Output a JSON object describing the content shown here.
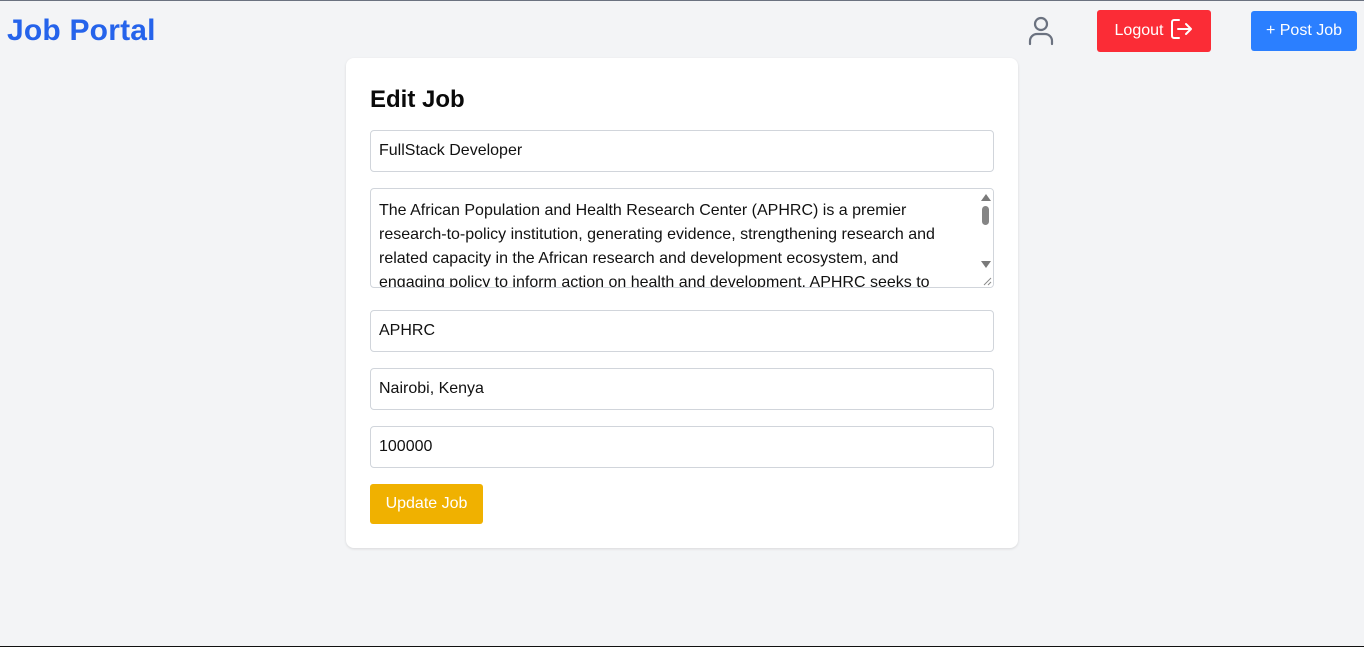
{
  "header": {
    "brand": "Job Portal",
    "logout_label": "Logout",
    "post_job_label": "+ Post Job"
  },
  "form": {
    "title": "Edit Job",
    "job_title": "FullStack Developer",
    "description": "The African Population and Health Research Center (APHRC) is a premier research-to-policy institution, generating evidence, strengthening research and related capacity in the African research and development ecosystem, and engaging policy to inform action on health and development. APHRC seeks to drive change by",
    "company": "APHRC",
    "location": "Nairobi, Kenya",
    "salary": "100000",
    "update_label": "Update Job"
  },
  "icons": {
    "user": "user-icon",
    "logout": "logout-icon"
  },
  "colors": {
    "brand": "#2563eb",
    "logout": "#fb2c36",
    "post_job": "#2b7fff",
    "update": "#f0b100",
    "background": "#f3f4f6"
  }
}
